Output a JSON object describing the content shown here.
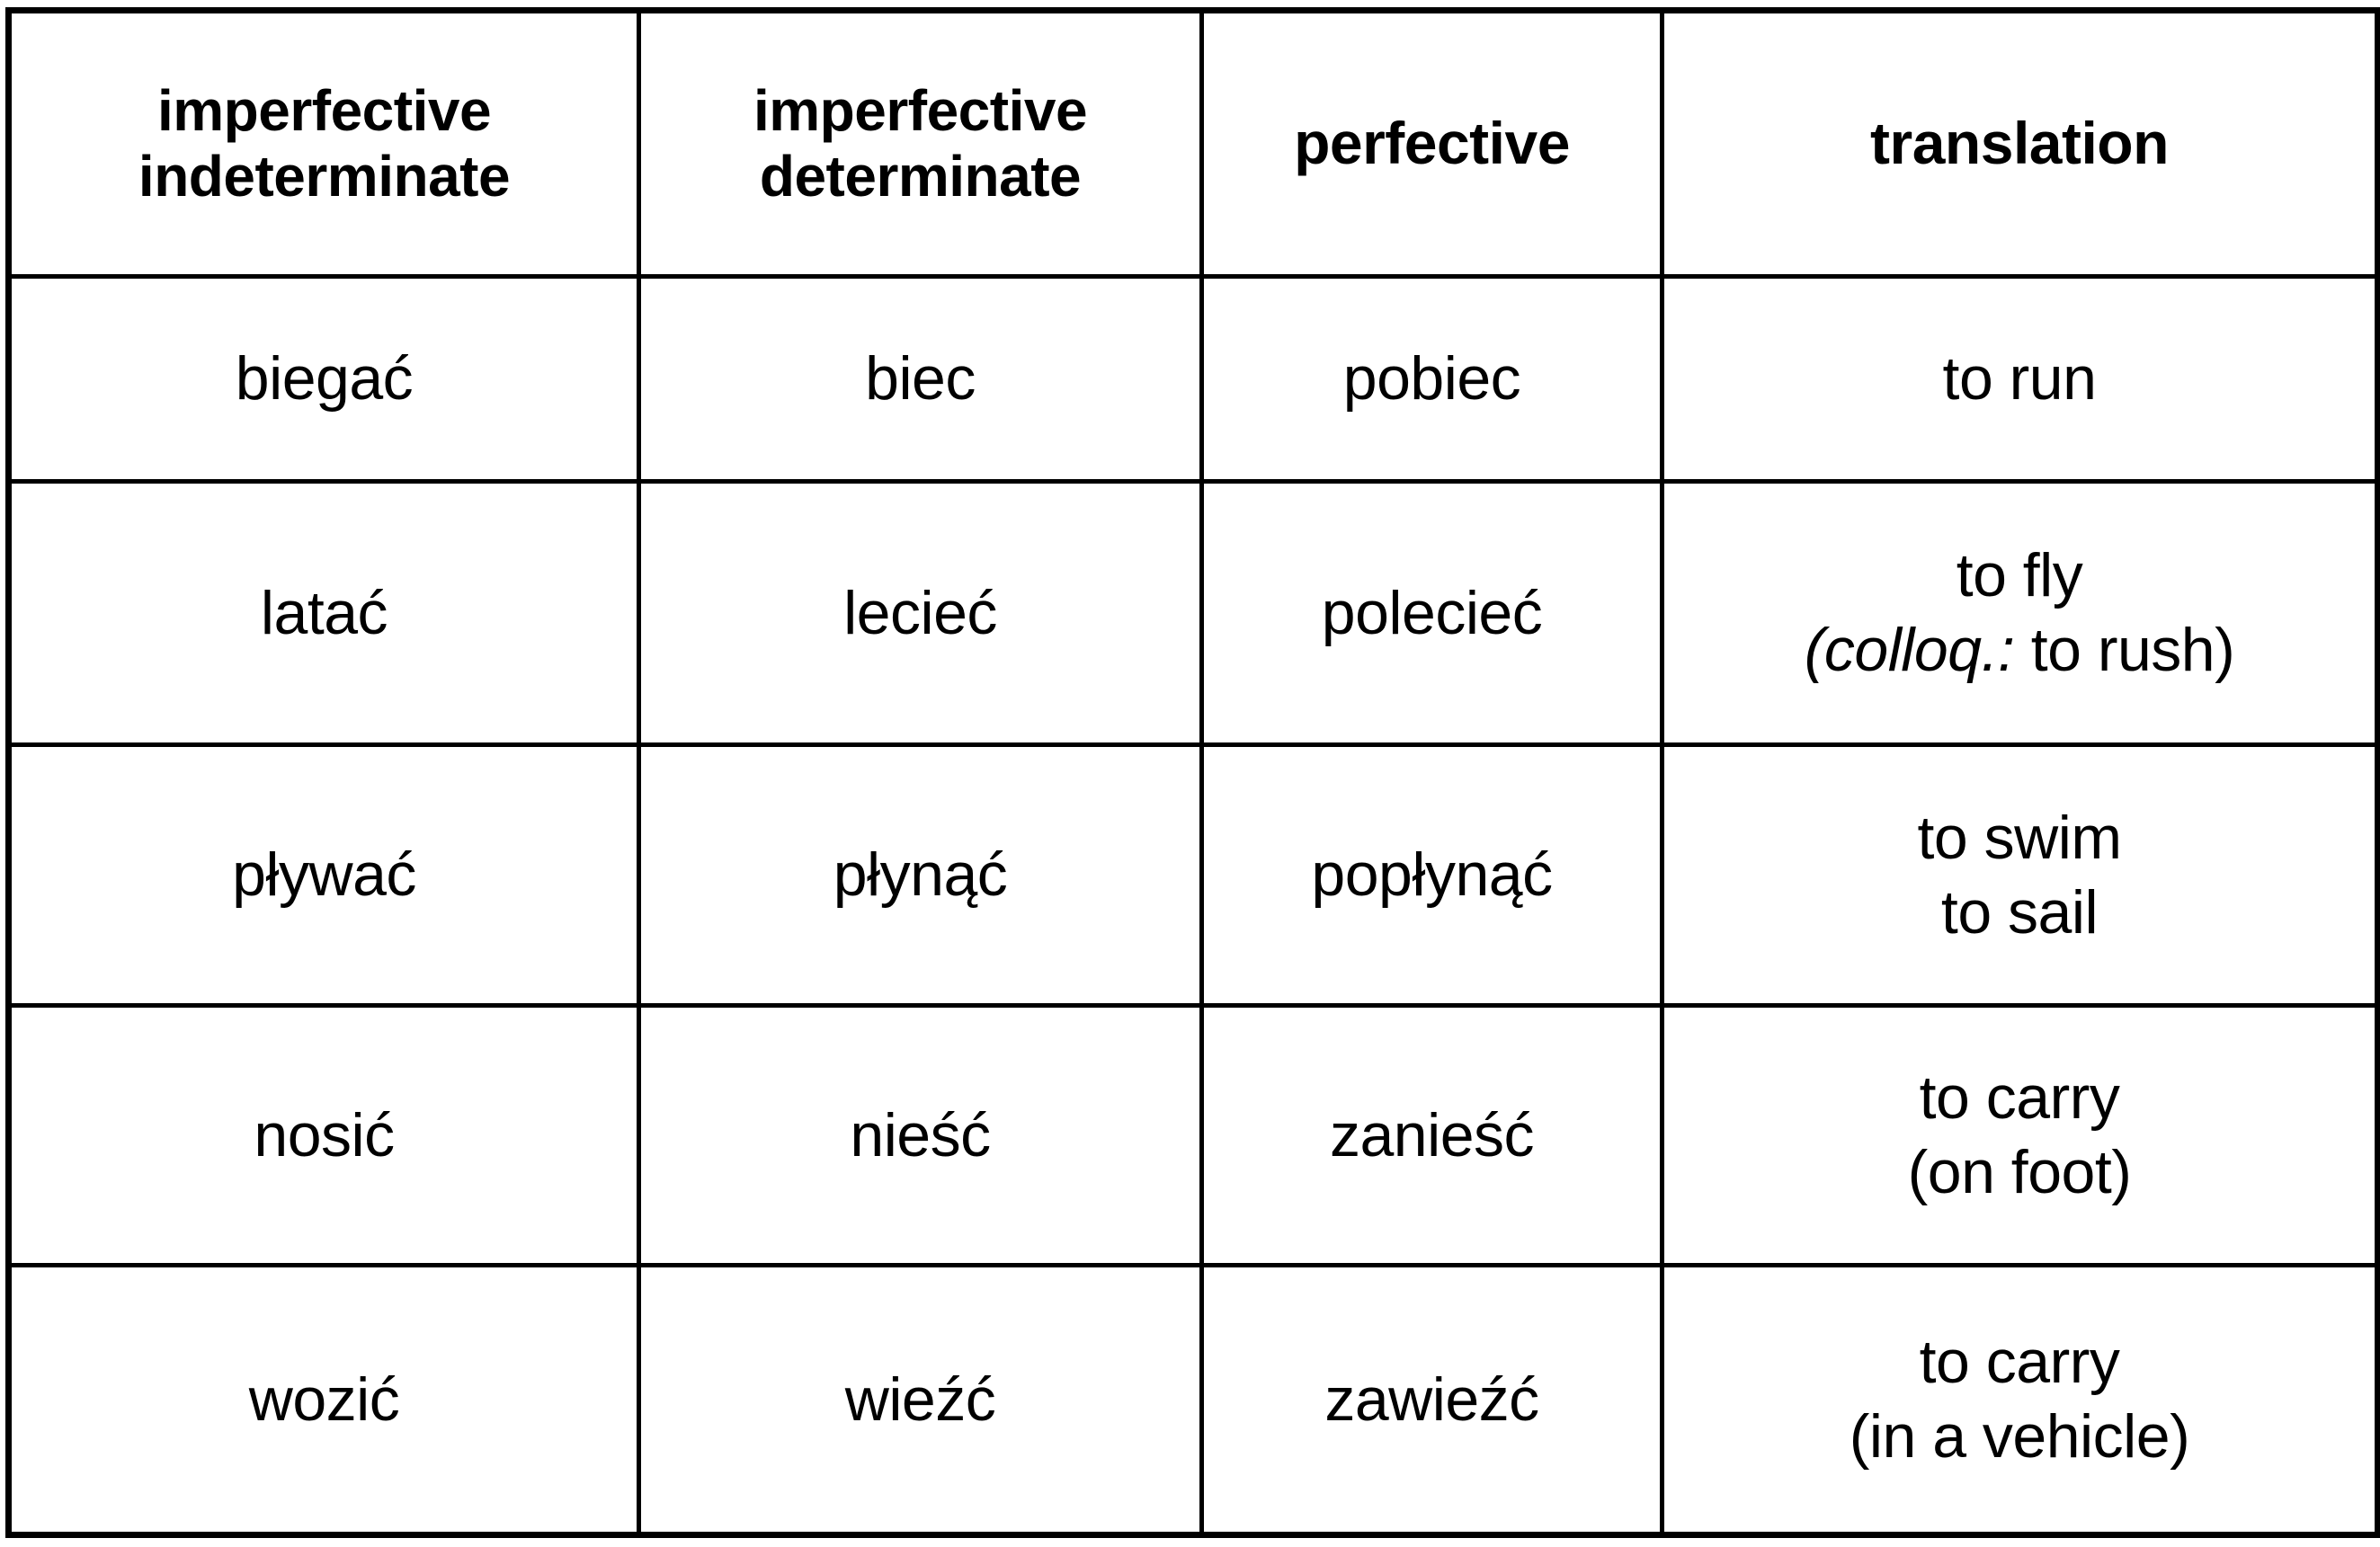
{
  "table": {
    "headers": [
      {
        "line1": "imperfective",
        "line2": "indeterminate"
      },
      {
        "line1": "imperfective",
        "line2": "determinate"
      },
      {
        "line1": "perfective",
        "line2": ""
      },
      {
        "line1": "translation",
        "line2": ""
      }
    ],
    "rows": [
      {
        "imperfective_indeterminate": "biegać",
        "imperfective_determinate": "biec",
        "perfective": "pobiec",
        "translation_line1": "to run",
        "translation_line2": "",
        "translation_line2_italic": "",
        "translation_line2_rest": ""
      },
      {
        "imperfective_indeterminate": "latać",
        "imperfective_determinate": "lecieć",
        "perfective": "polecieć",
        "translation_line1": "to fly",
        "translation_line2": "(colloq.: to rush)",
        "translation_line2_italic": "(colloq.:",
        "translation_line2_rest": " to rush)"
      },
      {
        "imperfective_indeterminate": "pływać",
        "imperfective_determinate": "płynąć",
        "perfective": "popłynąć",
        "translation_line1": "to swim",
        "translation_line2": "to sail",
        "translation_line2_italic": "",
        "translation_line2_rest": ""
      },
      {
        "imperfective_indeterminate": "nosić",
        "imperfective_determinate": "nieść",
        "perfective": "zanieść",
        "translation_line1": "to carry",
        "translation_line2": "(on foot)",
        "translation_line2_italic": "",
        "translation_line2_rest": ""
      },
      {
        "imperfective_indeterminate": "wozić",
        "imperfective_determinate": "wieźć",
        "perfective": "zawieźć",
        "translation_line1": "to carry",
        "translation_line2": "(in a vehicle)",
        "translation_line2_italic": "",
        "translation_line2_rest": ""
      }
    ]
  },
  "style": {
    "border_color": "#000000",
    "text_color": "#000000",
    "background": "#ffffff"
  }
}
